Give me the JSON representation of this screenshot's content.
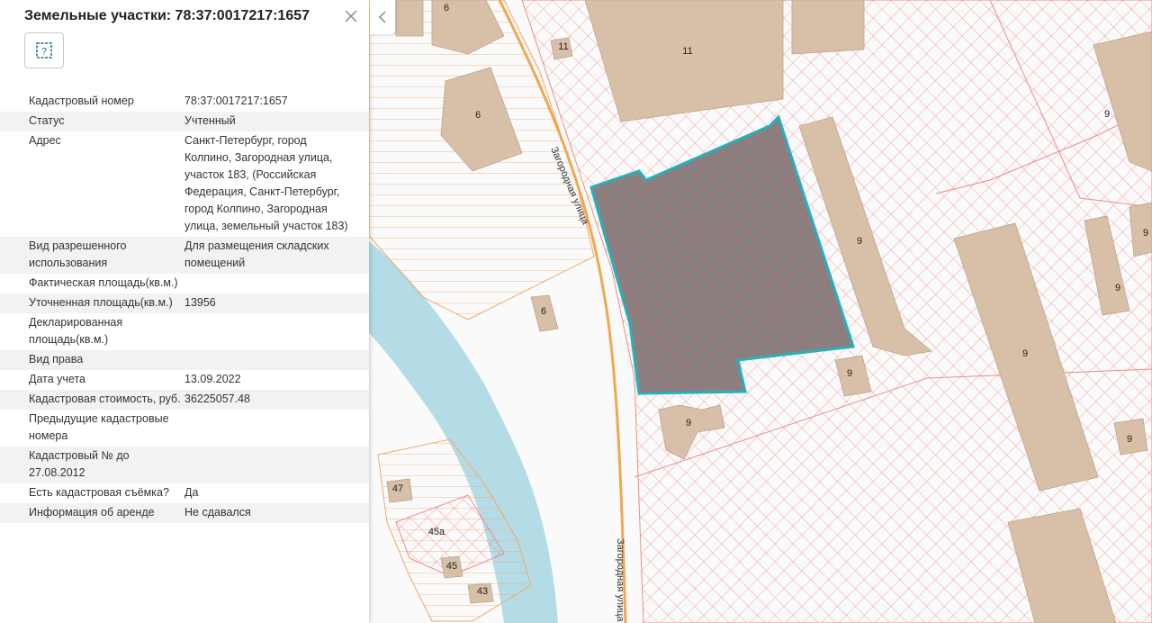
{
  "panel": {
    "title": "Земельные участки: 78:37:0017217:1657",
    "rows": [
      {
        "key": "Кадастровый номер",
        "value": "78:37:0017217:1657"
      },
      {
        "key": "Статус",
        "value": "Учтенный"
      },
      {
        "key": "Адрес",
        "value": "Санкт-Петербург, город Колпино, Загородная улица, участок 183, (Российская Федерация, Санкт-Петербург, город Колпино, Загородная улица, земельный участок 183)"
      },
      {
        "key": "Вид разрешенного использования",
        "value": "Для размещения складских помещений"
      },
      {
        "key": "Фактическая площадь(кв.м.)",
        "value": ""
      },
      {
        "key": "Уточненная площадь(кв.м.)",
        "value": "13956"
      },
      {
        "key": "Декларированная площадь(кв.м.)",
        "value": ""
      },
      {
        "key": "Вид права",
        "value": ""
      },
      {
        "key": "Дата учета",
        "value": "13.09.2022"
      },
      {
        "key": "Кадастровая стоимость, руб.",
        "value": "36225057.48"
      },
      {
        "key": "Предыдущие кадастровые номера",
        "value": ""
      },
      {
        "key": "Кадастровый № до 27.08.2012",
        "value": ""
      },
      {
        "key": "Есть кадастровая съёмка?",
        "value": "Да"
      },
      {
        "key": "Информация об аренде",
        "value": "Не сдавался"
      }
    ],
    "icons": {
      "close": "close-icon",
      "document": "document-question-icon",
      "collapse": "chevron-left-icon"
    }
  },
  "map": {
    "street_label": "Загородная улица",
    "building_labels": [
      "6",
      "6",
      "6",
      "11",
      "11",
      "9",
      "9",
      "9",
      "9",
      "9",
      "9",
      "9",
      "9",
      "47",
      "45а",
      "45",
      "43"
    ],
    "colors": {
      "background": "#fafafa",
      "water": "#b4dce6",
      "building": "#d8c0a8",
      "parcel_red": "#f08a8a",
      "parcel_orange": "#f2a764",
      "road": "#f0a850",
      "selected_fill": "#8a7f80",
      "selected_stroke": "#1fb3bd"
    }
  }
}
